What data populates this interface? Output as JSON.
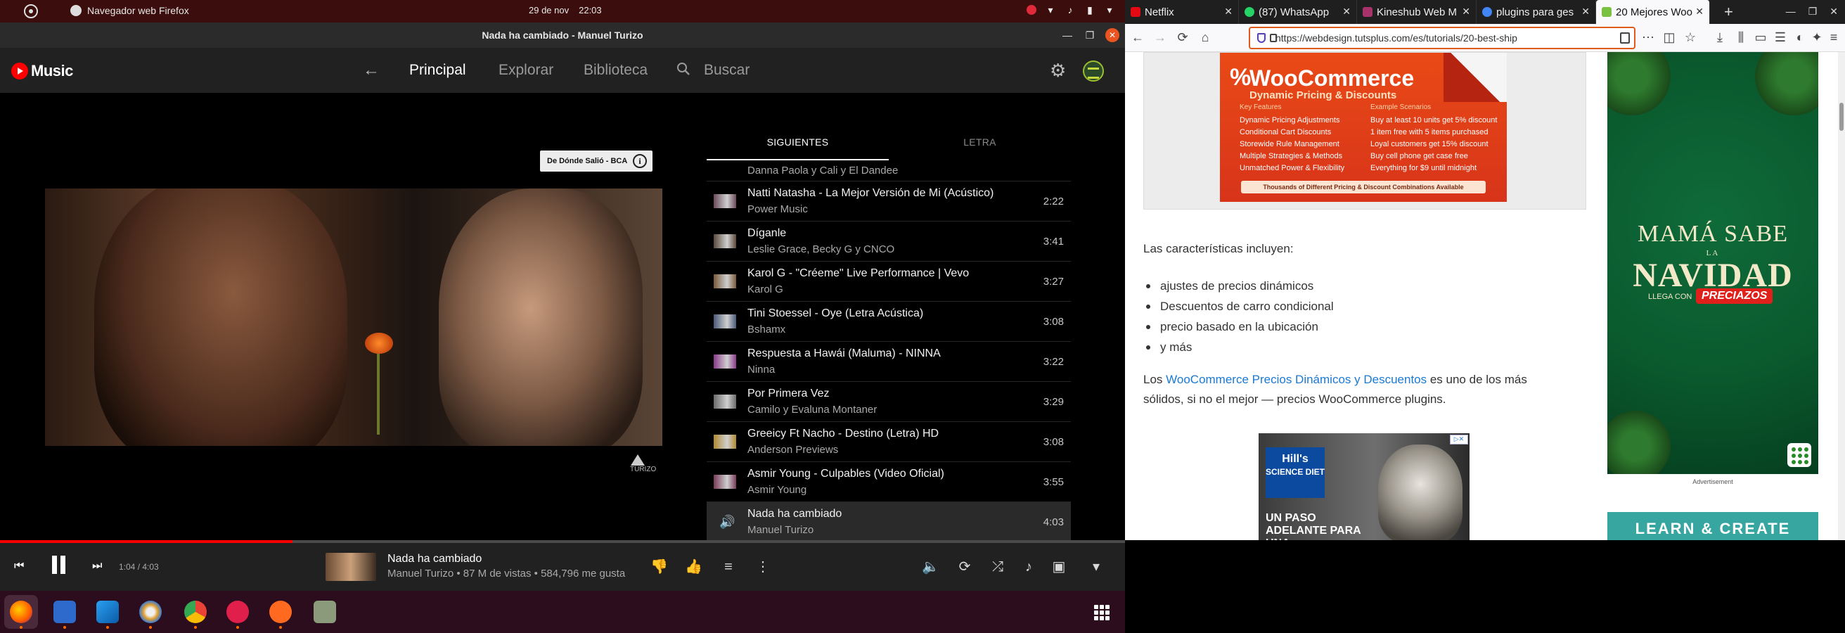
{
  "topbar": {
    "app_name": "Navegador web Firefox",
    "date": "29 de nov",
    "time": "22:03"
  },
  "window": {
    "title": "Nada ha cambiado - Manuel Turizo"
  },
  "ytmusic": {
    "logo_text": "Music",
    "nav": {
      "home": "Principal",
      "explore": "Explorar",
      "library": "Biblioteca",
      "search": "Buscar"
    },
    "info_card": "De Dónde Salió - BCA",
    "video_logo_text": "TURIZO",
    "queue_tabs": {
      "up_next": "SIGUIENTES",
      "lyrics": "LETRA"
    },
    "queue_partial_artist": "Danna Paola y Cali y El Dandee",
    "queue": [
      {
        "title": "Natti Natasha - La Mejor Versión de Mi (Acústico)",
        "artist": "Power Music",
        "duration": "2:22",
        "thumb_color": "#6b4a5a"
      },
      {
        "title": "Díganle",
        "artist": "Leslie Grace, Becky G y CNCO",
        "duration": "3:41",
        "thumb_color": "#5a4a3a"
      },
      {
        "title": "Karol G - \"Créeme\" Live Performance | Vevo",
        "artist": "Karol G",
        "duration": "3:27",
        "thumb_color": "#7a5a3a"
      },
      {
        "title": "Tini Stoessel - Oye (Letra Acústica)",
        "artist": "Bshamx",
        "duration": "3:08",
        "thumb_color": "#4a5a7a"
      },
      {
        "title": "Respuesta a Hawái (Maluma) - NINNA",
        "artist": "Ninna",
        "duration": "3:22",
        "thumb_color": "#8a3a8a"
      },
      {
        "title": "Por Primera Vez",
        "artist": "Camilo y Evaluna Montaner",
        "duration": "3:29",
        "thumb_color": "#6a6a6a"
      },
      {
        "title": "Greeicy Ft Nacho - Destino (Letra) HD",
        "artist": "Anderson Previews",
        "duration": "3:08",
        "thumb_color": "#b08a30"
      },
      {
        "title": "Asmir Young - Culpables (Video Oficial)",
        "artist": "Asmir Young",
        "duration": "3:55",
        "thumb_color": "#7a3a5a"
      }
    ],
    "current_track": {
      "title": "Nada ha cambiado",
      "artist": "Manuel Turizo",
      "duration": "4:03"
    },
    "player": {
      "time": "1:04 / 4:03",
      "progress": 0.26,
      "title": "Nada ha cambiado",
      "meta": "Manuel Turizo • 87 M de vistas • 584,796 me gusta"
    }
  },
  "firefox": {
    "tabs": [
      {
        "label": "Netflix",
        "favicon_color": "#e50914",
        "active": false
      },
      {
        "label": "(87) WhatsApp",
        "favicon_color": "#25d366",
        "active": false
      },
      {
        "label": "Kineshub Web M",
        "favicon_color": "#a8336a",
        "active": false
      },
      {
        "label": "plugins para ges",
        "favicon_color": "#4285f4",
        "active": false
      },
      {
        "label": "20 Mejores Woo",
        "favicon_color": "#7ac142",
        "active": true
      }
    ],
    "url": "https://webdesign.tutsplus.com/es/tutorials/20-best-ship"
  },
  "article": {
    "woo_ad": {
      "brand": "WooCommerce",
      "subtitle": "Dynamic Pricing & Discounts",
      "features_title": "Key Features",
      "features": [
        "Dynamic Pricing Adjustments",
        "Conditional Cart Discounts",
        "Storewide Rule Management",
        "Multiple Strategies & Methods",
        "Unmatched Power & Flexibility"
      ],
      "scenarios_title": "Example Scenarios",
      "scenarios": [
        "Buy at least 10 units get 5% discount",
        "1 item free with 5 items purchased",
        "Loyal customers get 15% discount",
        "Buy cell phone get case free",
        "Everything for $9 until midnight"
      ],
      "footer": "Thousands of Different Pricing & Discount Combinations Available"
    },
    "features_intro": "Las características incluyen:",
    "bullets": [
      "ajustes de precios dinámicos",
      "Descuentos de carro condicional",
      "precio basado en la ubicación",
      "y más"
    ],
    "para_prefix": "Los ",
    "para_link": "WooCommerce Precios Dinámicos y Descuentos",
    "para_suffix": " es uno de los más",
    "para_line2": "sólidos, si no el mejor — precios WooCommerce plugins.",
    "hills_ad": {
      "brand": "Hill's",
      "product": "SCIENCE DIET",
      "tagline": "UN PASO ADELANTE PARA UNA"
    },
    "side_ad": {
      "line1": "MAMÁ SABE",
      "line2": "LA",
      "line3": "NAVIDAD",
      "line4": "LLEGA CON",
      "brand": "PRECIAZOS"
    },
    "ad_label": "Advertisement",
    "cta": "LEARN & CREATE"
  }
}
